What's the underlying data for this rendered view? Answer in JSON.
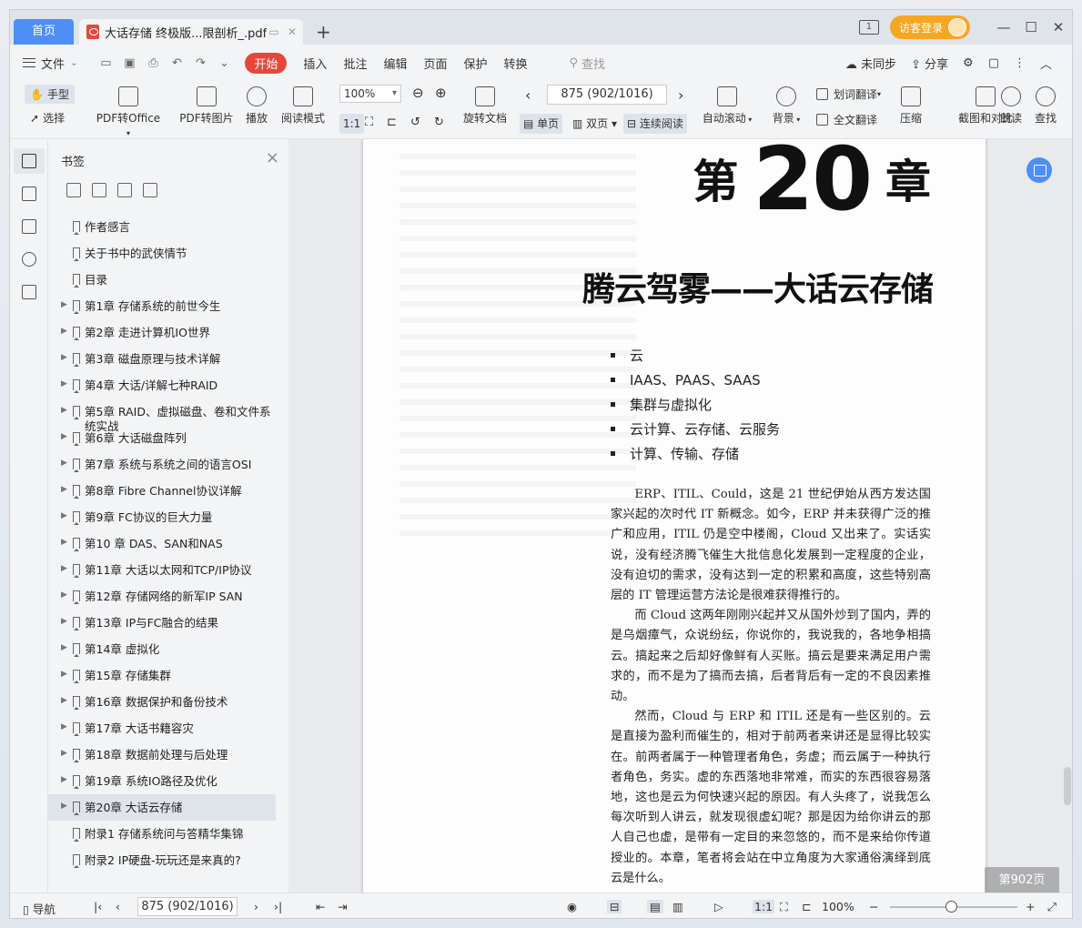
{
  "tabs": {
    "home": "首页",
    "doc_title": "大话存储 终极版...限剖析_.pdf",
    "new_tab": "+"
  },
  "titlebar": {
    "login": "访客登录"
  },
  "menu": {
    "file": "文件",
    "tabs": [
      "开始",
      "插入",
      "批注",
      "编辑",
      "页面",
      "保护",
      "转换"
    ],
    "search": "查找",
    "unsync": "未同步",
    "share": "分享"
  },
  "ribbon": {
    "hand": "手型",
    "select": "选择",
    "pdf_to_office": "PDF转Office",
    "pdf_to_image": "PDF转图片",
    "play": "播放",
    "read_mode": "阅读模式",
    "zoom": "100%",
    "rotate": "旋转文档",
    "page_indicator": "875 (902/1016)",
    "single": "单页",
    "double": "双页",
    "continuous": "连续阅读",
    "auto_scroll": "自动滚动",
    "background": "背景",
    "word_translate": "划词翻译",
    "full_translate": "全文翻译",
    "compress": "压缩",
    "crop_compare": "截图和对比",
    "read_aloud": "朗读",
    "find": "查找"
  },
  "bookmarks": {
    "header": "书签",
    "items": [
      {
        "label": "作者感言",
        "expandable": false
      },
      {
        "label": "关于书中的武侠情节",
        "expandable": false
      },
      {
        "label": "目录",
        "expandable": false
      },
      {
        "label": "第1章  存储系统的前世今生",
        "expandable": true
      },
      {
        "label": "第2章  走进计算机IO世界",
        "expandable": true
      },
      {
        "label": "第3章  磁盘原理与技术详解",
        "expandable": true
      },
      {
        "label": "第4章  大话/详解七种RAID",
        "expandable": true
      },
      {
        "label": "第5章 RAID、虚拟磁盘、卷和文件系统实战",
        "expandable": true
      },
      {
        "label": "第6章 大话磁盘阵列",
        "expandable": true
      },
      {
        "label": "第7章 系统与系统之间的语言OSI",
        "expandable": true
      },
      {
        "label": "第8章 Fibre Channel协议详解",
        "expandable": true
      },
      {
        "label": "第9章 FC协议的巨大力量",
        "expandable": true
      },
      {
        "label": "第10 章 DAS、SAN和NAS",
        "expandable": true
      },
      {
        "label": "第11章 大话以太网和TCP/IP协议",
        "expandable": true
      },
      {
        "label": "第12章 存储网络的新军IP SAN",
        "expandable": true
      },
      {
        "label": "第13章 IP与FC融合的结果",
        "expandable": true
      },
      {
        "label": "第14章 虚拟化",
        "expandable": true
      },
      {
        "label": "第15章 存储集群",
        "expandable": true
      },
      {
        "label": "第16章 数据保护和备份技术",
        "expandable": true
      },
      {
        "label": "第17章 大话书籍容灾",
        "expandable": true
      },
      {
        "label": "第18章 数据前处理与后处理",
        "expandable": true
      },
      {
        "label": "第19章 系统IO路径及优化",
        "expandable": true
      },
      {
        "label": "第20章 大话云存储",
        "expandable": true,
        "selected": true
      },
      {
        "label": "附录1 存储系统问与答精华集锦",
        "expandable": false
      },
      {
        "label": "附录2 IP硬盘-玩玩还是来真的?",
        "expandable": false
      }
    ]
  },
  "page": {
    "chapter_prefix": "第",
    "chapter_number": "20",
    "chapter_suffix": "章",
    "title": "腾云驾雾——大话云存储",
    "bullets": [
      "云",
      "IAAS、PAAS、SAAS",
      "集群与虚拟化",
      "云计算、云存储、云服务",
      "计算、传输、存储"
    ],
    "paragraphs": [
      "ERP、ITIL、Could，这是 21 世纪伊始从西方发达国家兴起的次时代 IT 新概念。如今，ERP 并未获得广泛的推广和应用，ITIL 仍是空中楼阁，Cloud 又出来了。实话实说，没有经济腾飞催生大批信息化发展到一定程度的企业，没有迫切的需求，没有达到一定的积累和高度，这些特别高层的 IT 管理运营方法论是很难获得推行的。",
      "而 Cloud 这两年刚刚兴起并又从国外炒到了国内，弄的是乌烟瘴气，众说纷纭，你说你的，我说我的，各地争相搞云。搞起来之后却好像鲜有人买账。搞云是要来满足用户需求的，而不是为了搞而去搞，后者背后有一定的不良因素推动。",
      "然而，Cloud 与 ERP 和 ITIL 还是有一些区别的。云是直接为盈利而催生的，相对于前两者来讲还是显得比较实在。前两者属于一种管理者角色，务虚；而云属于一种执行者角色，务实。虚的东西落地非常难，而实的东西很容易落地，这也是云为何快速兴起的原因。有人头疼了，说我怎么每次听到人讲云，就发现很虚幻呢？那是因为给你讲云的那人自己也虚，是带有一定目的来忽悠的，而不是来给你传道授业的。本章，笔者将会站在中立角度为大家通俗演绎到底云是什么。"
    ],
    "page_label": "第902页"
  },
  "status": {
    "nav": "导航",
    "page_indicator": "875 (902/1016)",
    "zoom": "100%"
  },
  "colors": {
    "accent": "#4d8ef7",
    "active_tab": "#e5483a",
    "login": "#f6a623"
  }
}
